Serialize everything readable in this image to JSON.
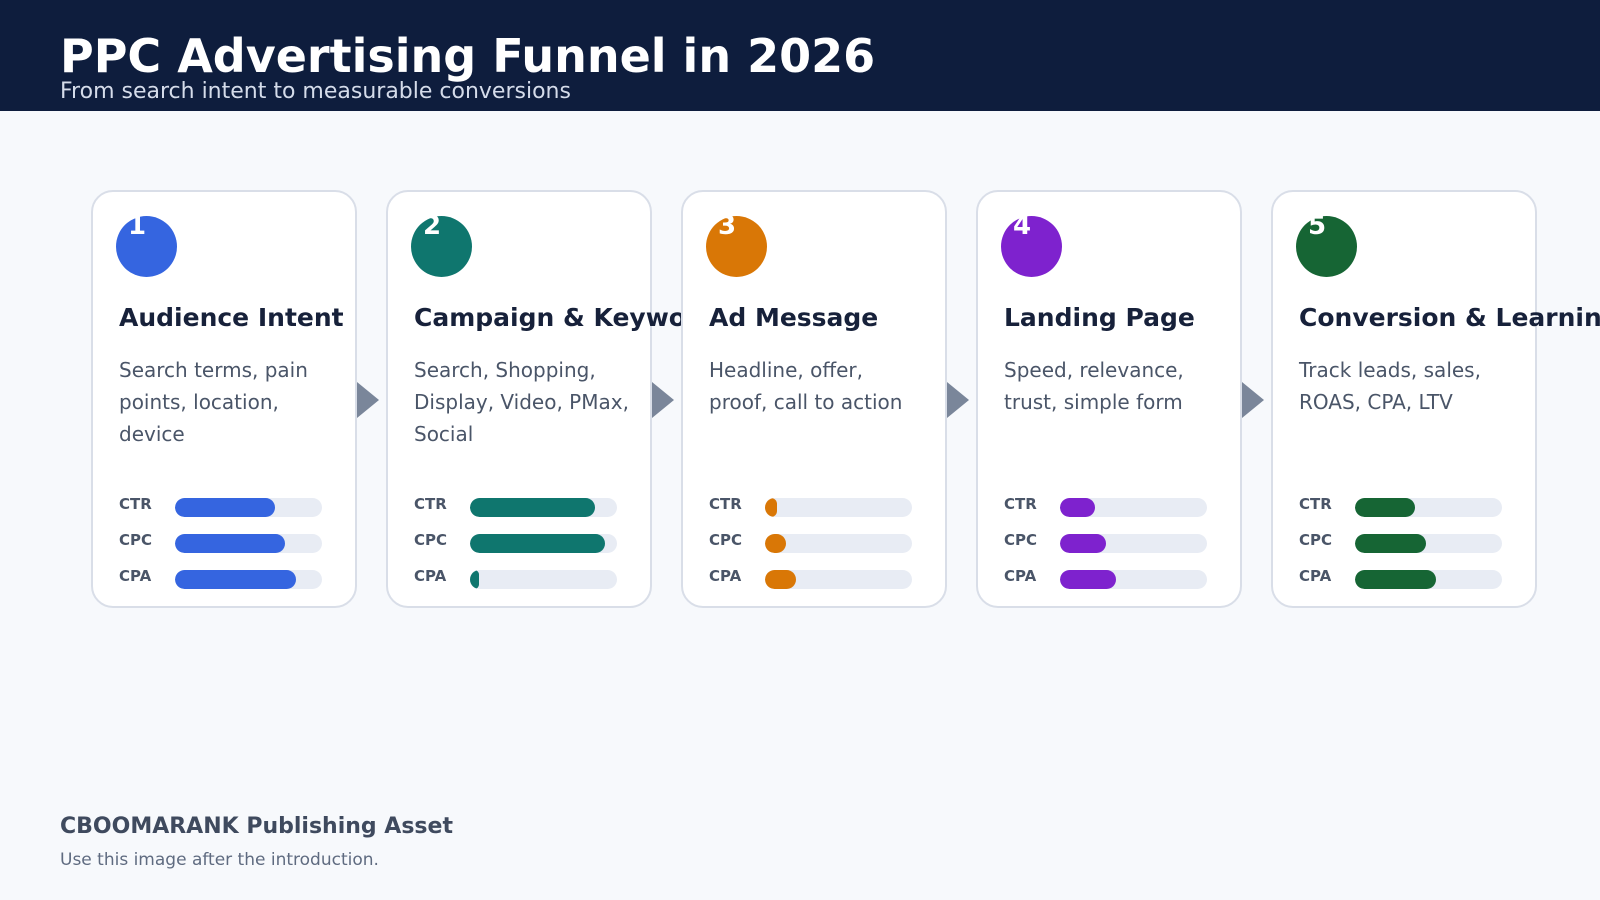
{
  "header": {
    "title": "PPC Advertising Funnel in 2026",
    "subtitle": "From search intent to measurable conversions"
  },
  "steps": [
    {
      "number": "1",
      "title": "Audience Intent",
      "description": "Search terms, pain points, location, device",
      "color": "#3565e0",
      "metrics": [
        {
          "label": "CTR",
          "value": 0.68
        },
        {
          "label": "CPC",
          "value": 0.75
        },
        {
          "label": "CPA",
          "value": 0.82
        }
      ]
    },
    {
      "number": "2",
      "title": "Campaign & Keywords",
      "description": "Search, Shopping, Display, Video, PMax, Social",
      "color": "#0f766e",
      "metrics": [
        {
          "label": "CTR",
          "value": 0.85
        },
        {
          "label": "CPC",
          "value": 0.92
        },
        {
          "label": "CPA",
          "value": 0.04
        }
      ]
    },
    {
      "number": "3",
      "title": "Ad Message",
      "description": "Headline, offer, proof, call to action",
      "color": "#d97706",
      "metrics": [
        {
          "label": "CTR",
          "value": 0.08
        },
        {
          "label": "CPC",
          "value": 0.14
        },
        {
          "label": "CPA",
          "value": 0.21
        }
      ]
    },
    {
      "number": "4",
      "title": "Landing Page",
      "description": "Speed, relevance, trust, simple form",
      "color": "#7e22ce",
      "metrics": [
        {
          "label": "CTR",
          "value": 0.24
        },
        {
          "label": "CPC",
          "value": 0.31
        },
        {
          "label": "CPA",
          "value": 0.38
        }
      ]
    },
    {
      "number": "5",
      "title": "Conversion & Learning",
      "description": "Track leads, sales, ROAS, CPA, LTV",
      "color": "#166534",
      "metrics": [
        {
          "label": "CTR",
          "value": 0.41
        },
        {
          "label": "CPC",
          "value": 0.48
        },
        {
          "label": "CPA",
          "value": 0.55
        }
      ]
    }
  ],
  "footer": {
    "brand": "CBOOMARANK Publishing Asset",
    "note": "Use this image after the introduction."
  }
}
